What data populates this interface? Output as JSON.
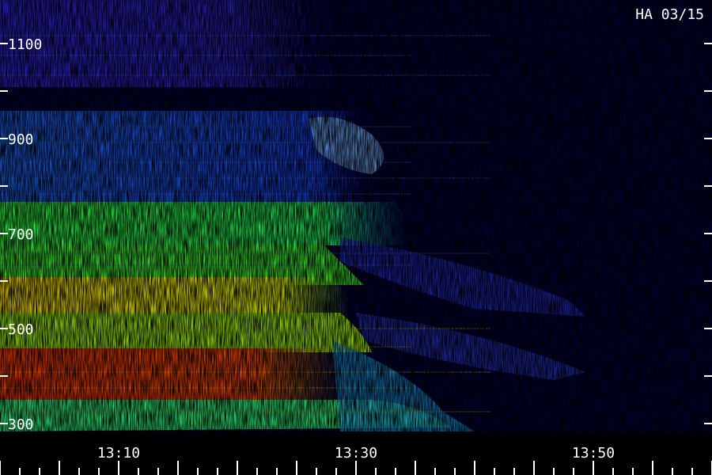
{
  "chart_data": {
    "type": "heatmap",
    "title": "HA 03/15",
    "y_ticks": [
      "300",
      "500",
      "700",
      "900",
      "1100"
    ],
    "x_ticks": [
      "13:10",
      "13:30",
      "13:50"
    ],
    "y_range": [
      280,
      1170
    ],
    "x_range_minutes": [
      13.1,
      13.59
    ],
    "colormap": [
      "#000000",
      "#1a10c8",
      "#1fa0ff",
      "#1fff2a",
      "#f5ff00",
      "#ff2a00"
    ]
  }
}
